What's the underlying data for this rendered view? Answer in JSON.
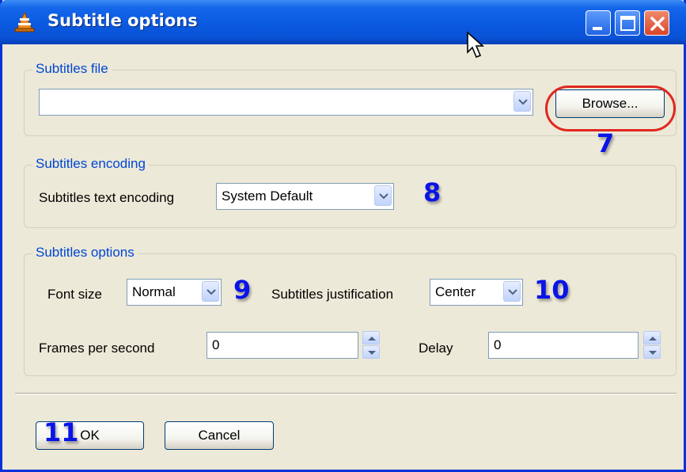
{
  "window": {
    "title": "Subtitle options",
    "title_icon": "vlc-cone-icon",
    "controls": [
      "minimize-icon",
      "maximize-icon",
      "close-icon"
    ]
  },
  "subtitles_file": {
    "legend": "Subtitles file",
    "path_value": "",
    "browse_label": "Browse..."
  },
  "subtitles_encoding": {
    "legend": "Subtitles encoding",
    "label": "Subtitles text encoding",
    "value": "System Default"
  },
  "subtitles_options": {
    "legend": "Subtitles options",
    "font_size_label": "Font size",
    "font_size_value": "Normal",
    "justification_label": "Subtitles justification",
    "justification_value": "Center",
    "fps_label": "Frames per second",
    "fps_value": "0",
    "delay_label": "Delay",
    "delay_value": "0"
  },
  "buttons": {
    "ok_label": "OK",
    "cancel_label": "Cancel"
  },
  "callouts": {
    "browse": "7",
    "encoding": "8",
    "font_size": "9",
    "justification": "10",
    "ok": "11"
  },
  "colors": {
    "titlebar": "#0a59e0",
    "legend_text": "#0046d5",
    "callout": "#0a14e8",
    "highlight": "#e2261f"
  }
}
